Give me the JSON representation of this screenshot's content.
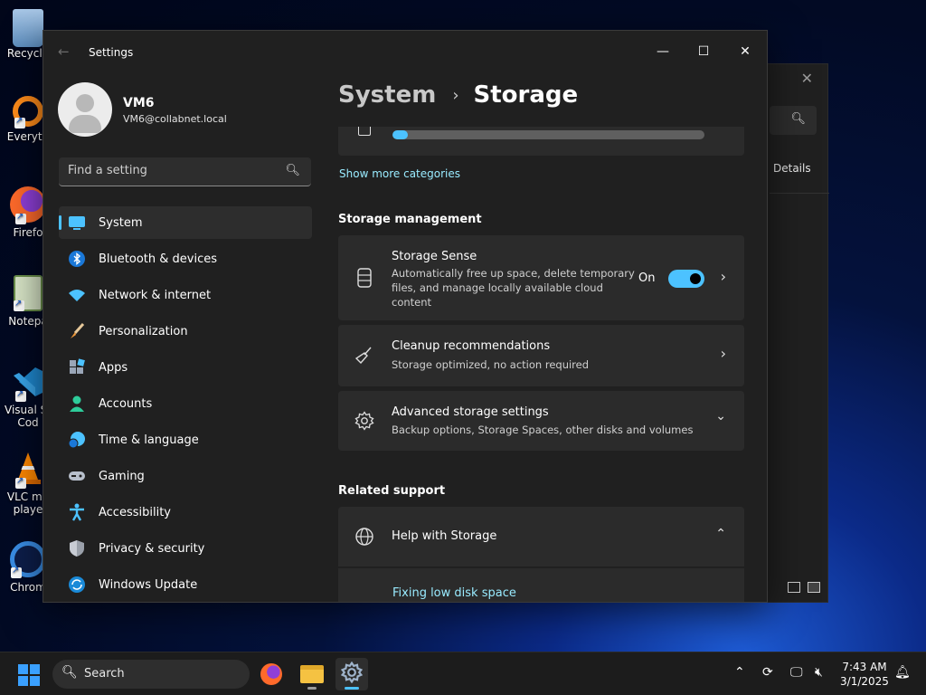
{
  "desktop": {
    "icons": [
      {
        "label": "Recycle"
      },
      {
        "label": "Everyth"
      },
      {
        "label": "Firefo"
      },
      {
        "label": "Notepa"
      },
      {
        "label": "Visual St\nCod"
      },
      {
        "label": "VLC me\nplaye"
      },
      {
        "label": "Chrom"
      }
    ]
  },
  "bg_window": {
    "details_label": "Details"
  },
  "window": {
    "title": "Settings"
  },
  "profile": {
    "name": "VM6",
    "email": "VM6@collabnet.local"
  },
  "search": {
    "placeholder": "Find a setting"
  },
  "nav": {
    "items": [
      {
        "label": "System",
        "icon": "system-icon"
      },
      {
        "label": "Bluetooth & devices",
        "icon": "bluetooth-icon"
      },
      {
        "label": "Network & internet",
        "icon": "network-icon"
      },
      {
        "label": "Personalization",
        "icon": "brush-icon"
      },
      {
        "label": "Apps",
        "icon": "apps-icon"
      },
      {
        "label": "Accounts",
        "icon": "accounts-icon"
      },
      {
        "label": "Time & language",
        "icon": "clock-globe-icon"
      },
      {
        "label": "Gaming",
        "icon": "gamepad-icon"
      },
      {
        "label": "Accessibility",
        "icon": "accessibility-icon"
      },
      {
        "label": "Privacy & security",
        "icon": "shield-icon"
      },
      {
        "label": "Windows Update",
        "icon": "update-icon"
      }
    ]
  },
  "breadcrumb": {
    "parent": "System",
    "current": "Storage"
  },
  "storage": {
    "bin_usage_fraction": 0.05,
    "show_more_label": "Show more categories",
    "management_heading": "Storage management",
    "sense": {
      "title": "Storage Sense",
      "desc_lines": [
        "Automatically free up space, delete temporary",
        "files, and manage locally available cloud",
        "content"
      ],
      "toggle_label": "On",
      "toggle_on": true
    },
    "cleanup": {
      "title": "Cleanup recommendations",
      "desc": "Storage optimized, no action required"
    },
    "advanced": {
      "title": "Advanced storage settings",
      "desc": "Backup options, Storage Spaces, other disks and volumes"
    },
    "related_heading": "Related support",
    "help": {
      "title": "Help with Storage",
      "link": "Fixing low disk space"
    }
  },
  "taskbar": {
    "search_label": "Search",
    "time": "7:43 AM",
    "date": "3/1/2025"
  },
  "colors": {
    "accent": "#4cc2ff",
    "link": "#99ebff",
    "window_bg": "#202020",
    "card_bg": "#2b2b2b"
  }
}
